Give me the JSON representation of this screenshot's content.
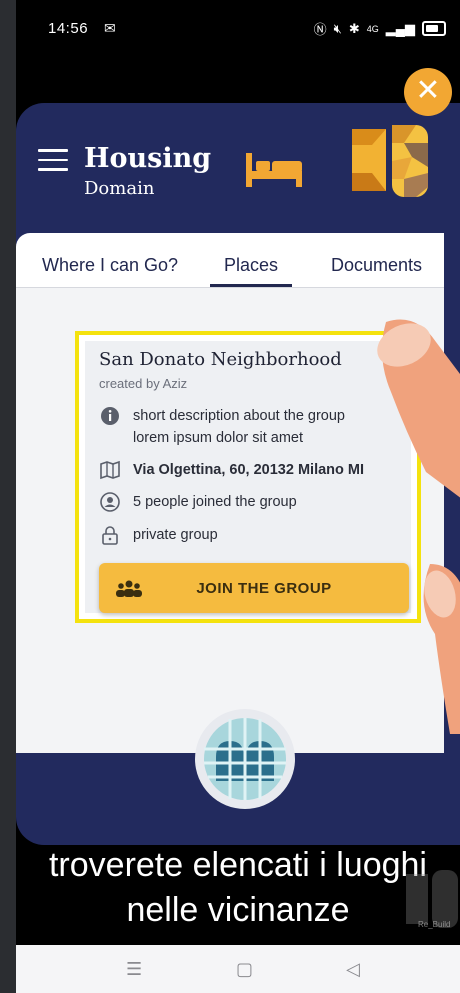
{
  "status": {
    "time": "14:56",
    "network": "4G"
  },
  "header": {
    "title": "Housing",
    "subtitle": "Domain"
  },
  "tabs": [
    {
      "label": "Where I can Go?"
    },
    {
      "label": "Places",
      "selected": true
    },
    {
      "label": "Documents"
    }
  ],
  "card": {
    "title": "San Donato Neighborhood",
    "created_by": "created by Aziz",
    "description_line1": "short description about the group",
    "description_line2": "lorem ipsum dolor sit amet",
    "address": "Via Olgettina, 60, 20132 Milano MI",
    "members": "5 people joined the group",
    "privacy": "private group",
    "join_label": "JOIN THE GROUP"
  },
  "subtitle": {
    "line1": "troverete elencati i luoghi",
    "line2": "nelle vicinanze"
  },
  "watermark": "Re_Build",
  "colors": {
    "dialog": "#222a5e",
    "accent": "#f2a733",
    "join_button": "#f5bb3f",
    "highlight_frame": "#f4e20e"
  }
}
